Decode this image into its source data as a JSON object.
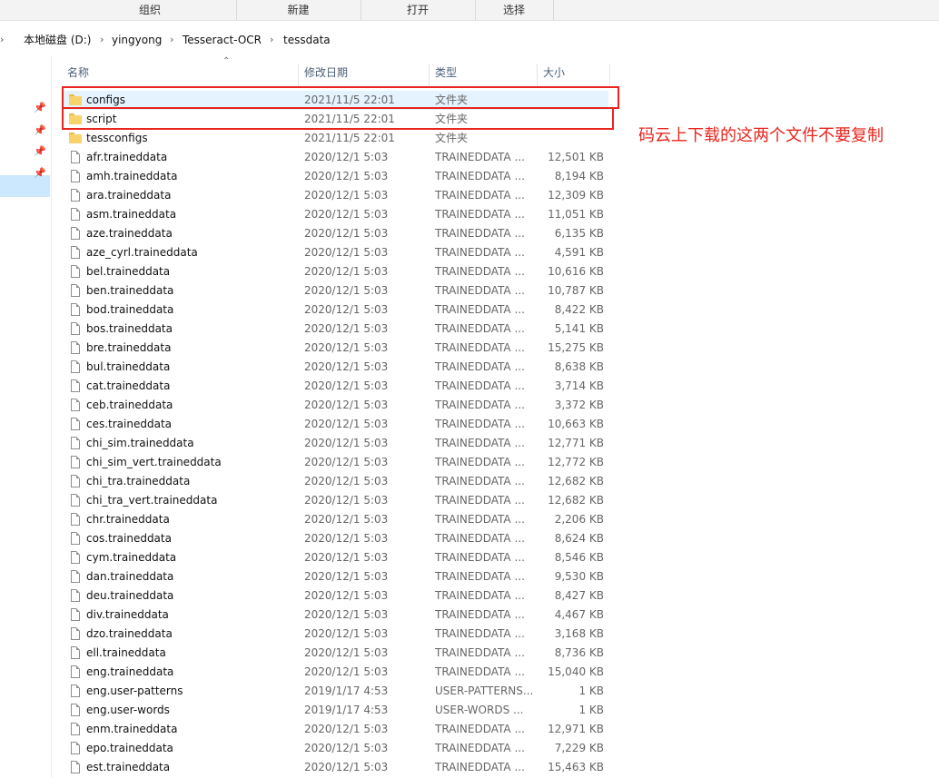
{
  "ribbon": {
    "groups": [
      "组织",
      "新建",
      "打开",
      "选择"
    ]
  },
  "address": {
    "crumbs": [
      "本地磁盘 (D:)",
      "yingyong",
      "Tesseract-OCR",
      "tessdata"
    ],
    "separator": "›"
  },
  "columns": {
    "name": "名称",
    "date": "修改日期",
    "type": "类型",
    "size": "大小"
  },
  "files": [
    {
      "name": "configs",
      "date": "2021/11/5 22:01",
      "type": "文件夹",
      "size": "",
      "kind": "folder"
    },
    {
      "name": "script",
      "date": "2021/11/5 22:01",
      "type": "文件夹",
      "size": "",
      "kind": "folder"
    },
    {
      "name": "tessconfigs",
      "date": "2021/11/5 22:01",
      "type": "文件夹",
      "size": "",
      "kind": "folder"
    },
    {
      "name": "afr.traineddata",
      "date": "2020/12/1 5:03",
      "type": "TRAINEDDATA ...",
      "size": "12,501 KB",
      "kind": "file"
    },
    {
      "name": "amh.traineddata",
      "date": "2020/12/1 5:03",
      "type": "TRAINEDDATA ...",
      "size": "8,194 KB",
      "kind": "file"
    },
    {
      "name": "ara.traineddata",
      "date": "2020/12/1 5:03",
      "type": "TRAINEDDATA ...",
      "size": "12,309 KB",
      "kind": "file"
    },
    {
      "name": "asm.traineddata",
      "date": "2020/12/1 5:03",
      "type": "TRAINEDDATA ...",
      "size": "11,051 KB",
      "kind": "file"
    },
    {
      "name": "aze.traineddata",
      "date": "2020/12/1 5:03",
      "type": "TRAINEDDATA ...",
      "size": "6,135 KB",
      "kind": "file"
    },
    {
      "name": "aze_cyrl.traineddata",
      "date": "2020/12/1 5:03",
      "type": "TRAINEDDATA ...",
      "size": "4,591 KB",
      "kind": "file"
    },
    {
      "name": "bel.traineddata",
      "date": "2020/12/1 5:03",
      "type": "TRAINEDDATA ...",
      "size": "10,616 KB",
      "kind": "file"
    },
    {
      "name": "ben.traineddata",
      "date": "2020/12/1 5:03",
      "type": "TRAINEDDATA ...",
      "size": "10,787 KB",
      "kind": "file"
    },
    {
      "name": "bod.traineddata",
      "date": "2020/12/1 5:03",
      "type": "TRAINEDDATA ...",
      "size": "8,422 KB",
      "kind": "file"
    },
    {
      "name": "bos.traineddata",
      "date": "2020/12/1 5:03",
      "type": "TRAINEDDATA ...",
      "size": "5,141 KB",
      "kind": "file"
    },
    {
      "name": "bre.traineddata",
      "date": "2020/12/1 5:03",
      "type": "TRAINEDDATA ...",
      "size": "15,275 KB",
      "kind": "file"
    },
    {
      "name": "bul.traineddata",
      "date": "2020/12/1 5:03",
      "type": "TRAINEDDATA ...",
      "size": "8,638 KB",
      "kind": "file"
    },
    {
      "name": "cat.traineddata",
      "date": "2020/12/1 5:03",
      "type": "TRAINEDDATA ...",
      "size": "3,714 KB",
      "kind": "file"
    },
    {
      "name": "ceb.traineddata",
      "date": "2020/12/1 5:03",
      "type": "TRAINEDDATA ...",
      "size": "3,372 KB",
      "kind": "file"
    },
    {
      "name": "ces.traineddata",
      "date": "2020/12/1 5:03",
      "type": "TRAINEDDATA ...",
      "size": "10,663 KB",
      "kind": "file"
    },
    {
      "name": "chi_sim.traineddata",
      "date": "2020/12/1 5:03",
      "type": "TRAINEDDATA ...",
      "size": "12,771 KB",
      "kind": "file"
    },
    {
      "name": "chi_sim_vert.traineddata",
      "date": "2020/12/1 5:03",
      "type": "TRAINEDDATA ...",
      "size": "12,772 KB",
      "kind": "file"
    },
    {
      "name": "chi_tra.traineddata",
      "date": "2020/12/1 5:03",
      "type": "TRAINEDDATA ...",
      "size": "12,682 KB",
      "kind": "file"
    },
    {
      "name": "chi_tra_vert.traineddata",
      "date": "2020/12/1 5:03",
      "type": "TRAINEDDATA ...",
      "size": "12,682 KB",
      "kind": "file"
    },
    {
      "name": "chr.traineddata",
      "date": "2020/12/1 5:03",
      "type": "TRAINEDDATA ...",
      "size": "2,206 KB",
      "kind": "file"
    },
    {
      "name": "cos.traineddata",
      "date": "2020/12/1 5:03",
      "type": "TRAINEDDATA ...",
      "size": "8,624 KB",
      "kind": "file"
    },
    {
      "name": "cym.traineddata",
      "date": "2020/12/1 5:03",
      "type": "TRAINEDDATA ...",
      "size": "8,546 KB",
      "kind": "file"
    },
    {
      "name": "dan.traineddata",
      "date": "2020/12/1 5:03",
      "type": "TRAINEDDATA ...",
      "size": "9,530 KB",
      "kind": "file"
    },
    {
      "name": "deu.traineddata",
      "date": "2020/12/1 5:03",
      "type": "TRAINEDDATA ...",
      "size": "8,427 KB",
      "kind": "file"
    },
    {
      "name": "div.traineddata",
      "date": "2020/12/1 5:03",
      "type": "TRAINEDDATA ...",
      "size": "4,467 KB",
      "kind": "file"
    },
    {
      "name": "dzo.traineddata",
      "date": "2020/12/1 5:03",
      "type": "TRAINEDDATA ...",
      "size": "3,168 KB",
      "kind": "file"
    },
    {
      "name": "ell.traineddata",
      "date": "2020/12/1 5:03",
      "type": "TRAINEDDATA ...",
      "size": "8,736 KB",
      "kind": "file"
    },
    {
      "name": "eng.traineddata",
      "date": "2020/12/1 5:03",
      "type": "TRAINEDDATA ...",
      "size": "15,040 KB",
      "kind": "file"
    },
    {
      "name": "eng.user-patterns",
      "date": "2019/1/17 4:53",
      "type": "USER-PATTERNS...",
      "size": "1 KB",
      "kind": "file"
    },
    {
      "name": "eng.user-words",
      "date": "2019/1/17 4:53",
      "type": "USER-WORDS ...",
      "size": "1 KB",
      "kind": "file"
    },
    {
      "name": "enm.traineddata",
      "date": "2020/12/1 5:03",
      "type": "TRAINEDDATA ...",
      "size": "12,971 KB",
      "kind": "file"
    },
    {
      "name": "epo.traineddata",
      "date": "2020/12/1 5:03",
      "type": "TRAINEDDATA ...",
      "size": "7,229 KB",
      "kind": "file"
    },
    {
      "name": "est.traineddata",
      "date": "2020/12/1 5:03",
      "type": "TRAINEDDATA ...",
      "size": "15,463 KB",
      "kind": "file"
    }
  ],
  "annotation": {
    "text": "码云上下载的这两个文件不要复制",
    "color": "#e8251e"
  }
}
